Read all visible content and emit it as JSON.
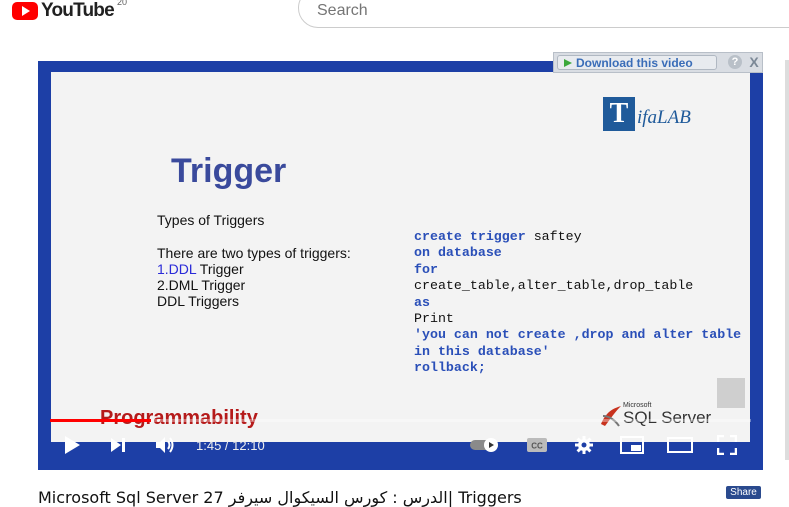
{
  "header": {
    "logo_text": "YouTube",
    "logo_sup": "20",
    "search_placeholder": "Search"
  },
  "download_bar": {
    "label": "Download this video",
    "help": "?",
    "close": "X"
  },
  "slide": {
    "brand_letter": "T",
    "brand_text": "ifaLAB",
    "title": "Trigger",
    "lines": {
      "types_heading": "Types of Triggers",
      "two_types": "There are two types of triggers:",
      "item1_num": "1.DDL",
      "item1_rest": " Trigger",
      "item2": "2.DML Trigger",
      "item3": "DDL Triggers"
    },
    "code": {
      "l1_kw": "create trigger",
      "l1_rest": " saftey",
      "l2_kw": "on database",
      "l3_kw": "for",
      "l4": "create_table,alter_table,drop_table",
      "l5_kw": "as",
      "l6": "Print",
      "l7_kw": "'you can not create ,drop and alter table",
      "l8_kw": "in this database'",
      "l9_kw": "rollback;"
    },
    "sql_small": "Microsoft",
    "sql_text": "SQL Server",
    "caption": "Programmability"
  },
  "player": {
    "current_time": "1:45",
    "duration": "12:10",
    "time_display": "1:45 / 12:10",
    "progress": 0.144,
    "accent": "#ff0000"
  },
  "video": {
    "title": "Microsoft Sql Server 27 الدرس : كورس السيكوال سيرفر| Triggers",
    "share_label": "Share"
  }
}
